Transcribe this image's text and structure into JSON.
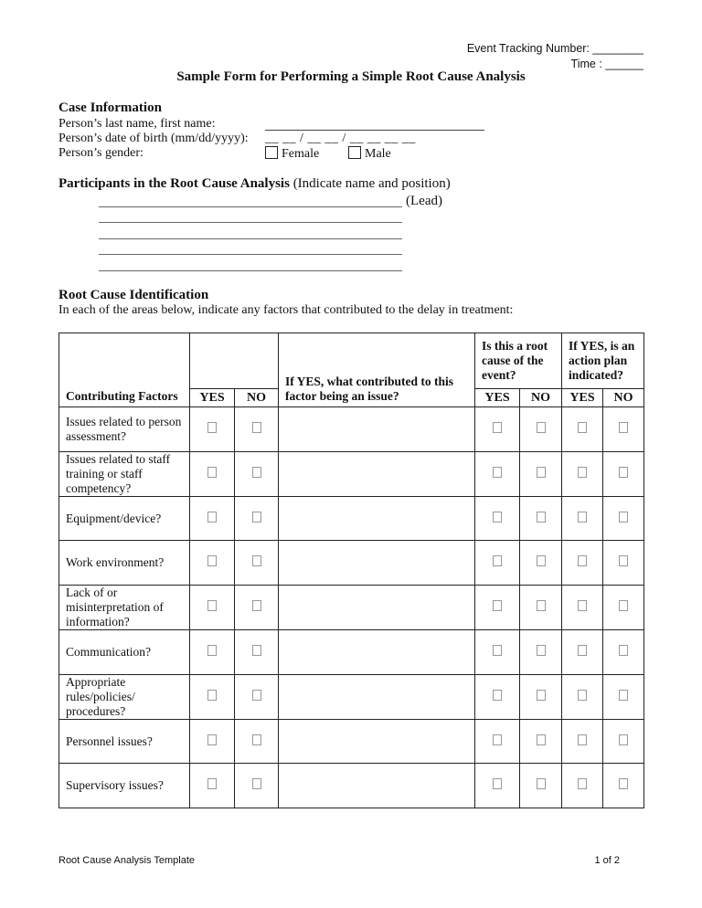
{
  "header": {
    "event_tracking_label": "Event Tracking Number: ________",
    "time_label": "Time : ______",
    "title": "Sample Form for Performing a Simple Root Cause Analysis"
  },
  "case_information": {
    "heading": "Case Information",
    "name_label": "Person’s last name, first name:",
    "dob_label": "Person’s date of birth (mm/dd/yyyy):",
    "dob_blank": "__ __ / __ __ / __ __ __ __",
    "gender_label": "Person’s gender:",
    "gender_options": [
      "Female",
      "Male"
    ]
  },
  "participants": {
    "heading": "Participants in the Root Cause Analysis",
    "instruction": "(Indicate name and position)",
    "lead_label": "(Lead)",
    "blank_lines": 5
  },
  "root_cause": {
    "heading": "Root Cause Identification",
    "instruction": "In each of the areas below, indicate any factors that contributed to the delay in treatment:",
    "table": {
      "col_factors": "Contributing Factors",
      "col_yes": "YES",
      "col_no": "NO",
      "col_contributed": "If YES, what contributed to this factor being an issue?",
      "col_root_cause": "Is this a root cause of the event?",
      "col_action_plan": "If YES, is an action plan indicated?",
      "rows": [
        {
          "factor": "Issues related to person assessment?"
        },
        {
          "factor": "Issues related to staff training or staff competency?"
        },
        {
          "factor": "Equipment/device?"
        },
        {
          "factor": "Work environment?"
        },
        {
          "factor": "Lack of or misinterpretation of information?"
        },
        {
          "factor": "Communication?"
        },
        {
          "factor": "Appropriate rules/policies/ procedures?"
        },
        {
          "factor": "Personnel issues?"
        },
        {
          "factor": "Supervisory issues?"
        }
      ]
    }
  },
  "footer": {
    "left": "Root Cause Analysis Template",
    "right": "1 of 2"
  }
}
